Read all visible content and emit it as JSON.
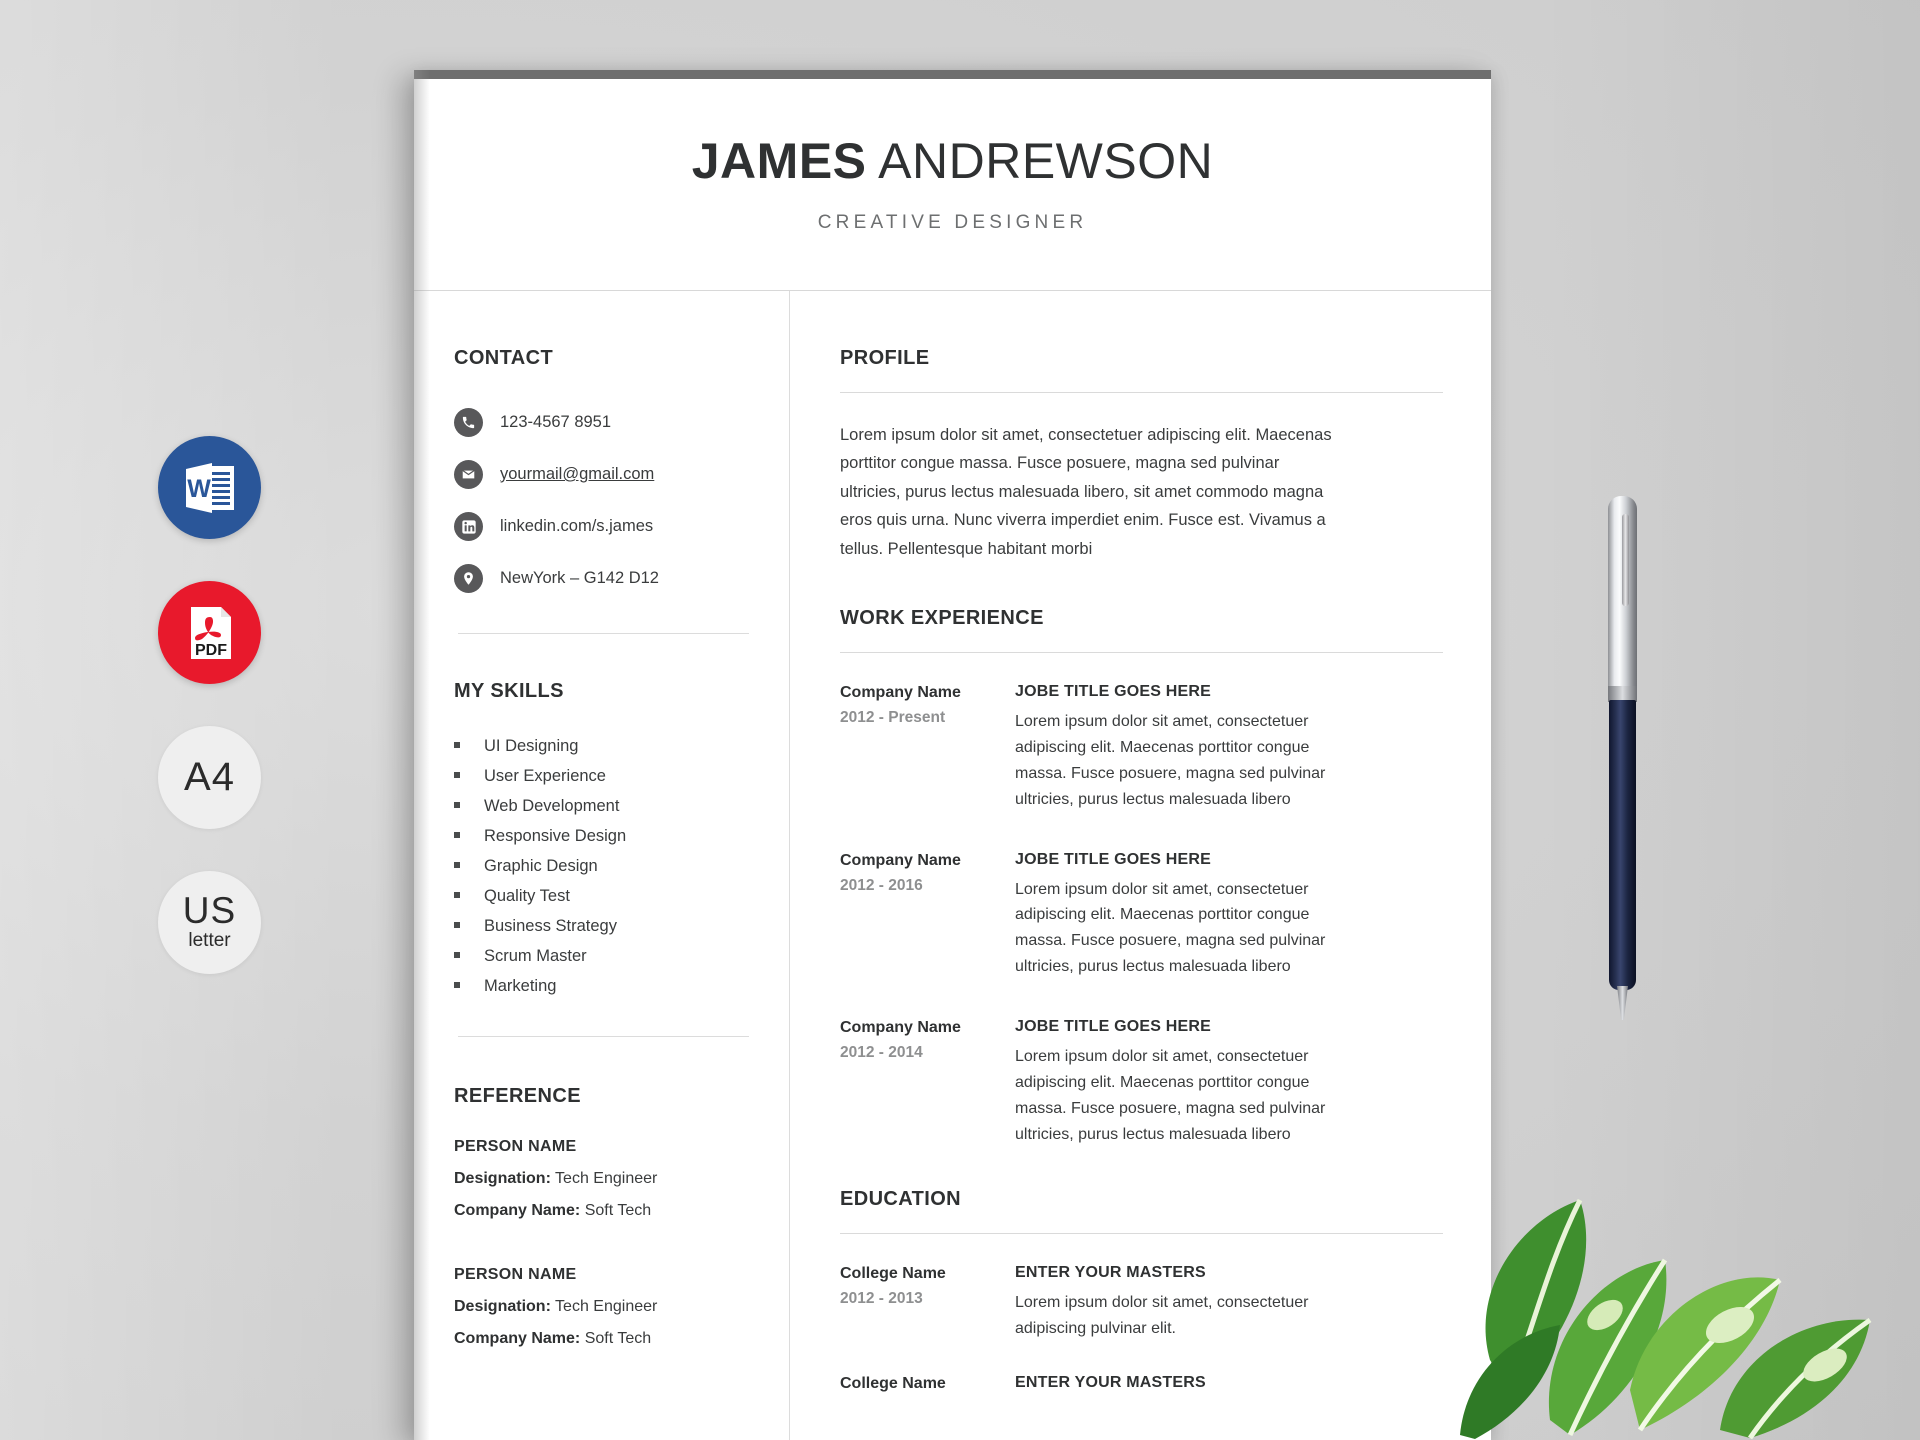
{
  "document": {
    "header": {
      "first_name": "JAMES",
      "last_name": "ANDREWSON",
      "role": "CREATIVE DESIGNER"
    },
    "contact": {
      "heading": "CONTACT",
      "items": [
        {
          "icon": "phone-icon",
          "value": "123-4567 8951",
          "link": false
        },
        {
          "icon": "envelope-icon",
          "value": "yourmail@gmail.com",
          "link": true
        },
        {
          "icon": "linkedin-icon",
          "value": "linkedin.com/s.james",
          "link": false
        },
        {
          "icon": "map-pin-icon",
          "value": "NewYork – G142 D12",
          "link": false
        }
      ]
    },
    "skills": {
      "heading": "MY SKILLS",
      "items": [
        "UI Designing",
        "User Experience",
        "Web Development",
        "Responsive Design",
        "Graphic Design",
        "Quality Test",
        "Business Strategy",
        "Scrum Master",
        "Marketing"
      ]
    },
    "reference": {
      "heading": "REFERENCE",
      "items": [
        {
          "name": "PERSON NAME",
          "designation_label": "Designation:",
          "designation_value": "Tech Engineer",
          "company_label": "Company Name:",
          "company_value": "Soft Tech"
        },
        {
          "name": "PERSON NAME",
          "designation_label": "Designation:",
          "designation_value": "Tech Engineer",
          "company_label": "Company Name:",
          "company_value": "Soft Tech"
        }
      ]
    },
    "profile": {
      "heading": "PROFILE",
      "text": "Lorem ipsum dolor sit amet, consectetuer adipiscing elit. Maecenas porttitor congue massa. Fusce posuere, magna sed pulvinar ultricies, purus lectus malesuada libero, sit amet commodo magna eros quis urna. Nunc viverra imperdiet enim. Fusce est. Vivamus a tellus. Pellentesque habitant morbi"
    },
    "work_experience": {
      "heading": "WORK EXPERIENCE",
      "entries": [
        {
          "company": "Company Name",
          "date": "2012 - Present",
          "title": "JOBE TITLE GOES HERE",
          "description": "Lorem ipsum dolor sit amet, consectetuer adipiscing elit. Maecenas porttitor congue massa. Fusce posuere, magna sed pulvinar ultricies, purus lectus malesuada libero"
        },
        {
          "company": "Company Name",
          "date": "2012 - 2016",
          "title": "JOBE TITLE GOES HERE",
          "description": "Lorem ipsum dolor sit amet, consectetuer adipiscing elit. Maecenas porttitor congue massa. Fusce posuere, magna sed pulvinar ultricies, purus lectus malesuada libero"
        },
        {
          "company": "Company Name",
          "date": "2012 - 2014",
          "title": "JOBE TITLE GOES HERE",
          "description": "Lorem ipsum dolor sit amet, consectetuer adipiscing elit. Maecenas porttitor congue massa. Fusce posuere, magna sed pulvinar ultricies, purus lectus malesuada libero"
        }
      ]
    },
    "education": {
      "heading": "EDUCATION",
      "entries": [
        {
          "college": "College Name",
          "date": "2012 - 2013",
          "title": "ENTER YOUR MASTERS",
          "description": "Lorem ipsum dolor sit amet, consectetuer adipiscing pulvinar elit."
        },
        {
          "college": "College Name",
          "date": "",
          "title": "ENTER YOUR MASTERS",
          "description": ""
        }
      ]
    }
  },
  "badges": [
    {
      "id": "word-badge",
      "type": "word",
      "label": "W",
      "color": "#2a5699"
    },
    {
      "id": "pdf-badge",
      "type": "pdf",
      "label": "PDF",
      "color": "#e8192c"
    },
    {
      "id": "a4-badge",
      "type": "plain",
      "label": "A4",
      "sub": "",
      "color": "#efefef"
    },
    {
      "id": "us-letter-badge",
      "type": "plain",
      "label": "US",
      "sub": "letter",
      "color": "#efefef"
    }
  ],
  "theme": {
    "background": "#d4d4d4",
    "page_background": "#ffffff",
    "topbar": "#6e6e6e",
    "heading_color": "#2f3132",
    "body_color": "#3a3c3d",
    "muted_color": "#8e8f90",
    "icon_circle": "#58585a"
  }
}
